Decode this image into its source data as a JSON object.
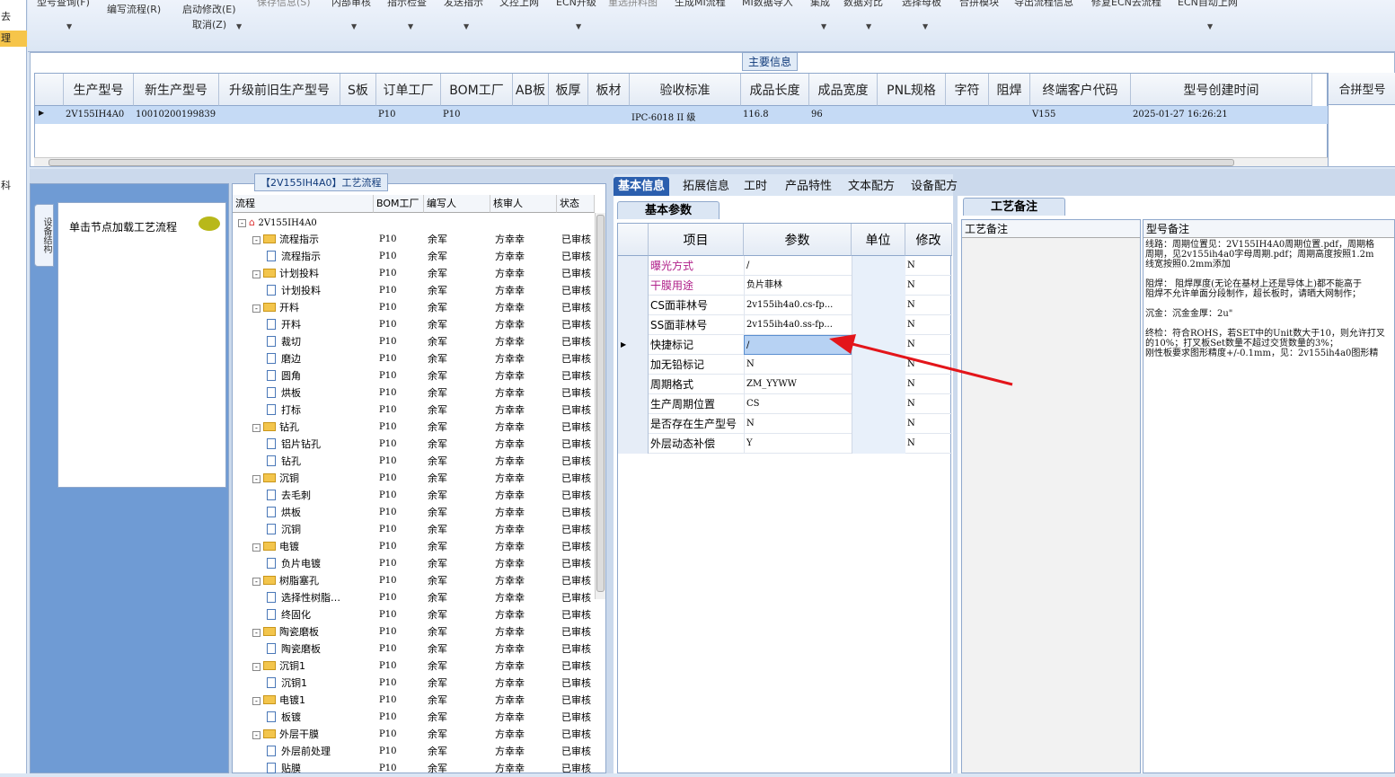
{
  "leftstrip": [
    "去",
    "理",
    "",
    "科"
  ],
  "ribbon": {
    "items": [
      {
        "label": "型号查询(F)",
        "dim": false
      },
      {
        "label": "编写流程(R)",
        "dim": false
      },
      {
        "label": "启动修改(E)",
        "dim": false
      },
      {
        "label": "取消(Z)",
        "dim": false
      },
      {
        "label": "保存信息(S)",
        "dim": true
      },
      {
        "label": "内部审核",
        "dim": false
      },
      {
        "label": "指示检查",
        "dim": false
      },
      {
        "label": "发送指示",
        "dim": false
      },
      {
        "label": "文控上网",
        "dim": false
      },
      {
        "label": "ECN升级",
        "dim": false
      },
      {
        "label": "重选拼料图",
        "dim": true
      },
      {
        "label": "生成MI流程",
        "dim": false
      },
      {
        "label": "MI数据导入",
        "dim": false
      },
      {
        "label": "集成",
        "dim": false
      },
      {
        "label": "数据对比",
        "dim": false
      },
      {
        "label": "选择母板",
        "dim": false
      },
      {
        "label": "合拼模块",
        "dim": false
      },
      {
        "label": "导出流程信息",
        "dim": false
      },
      {
        "label": "修复ECN去流程",
        "dim": false
      },
      {
        "label": "ECN自动上网",
        "dim": false
      }
    ]
  },
  "main_info": {
    "title": "主要信息",
    "columns": [
      "生产型号",
      "新生产型号",
      "升级前旧生产型号",
      "S板",
      "订单工厂",
      "BOM工厂",
      "AB板",
      "板厚",
      "板材",
      "验收标准",
      "成品长度",
      "成品宽度",
      "PNL规格",
      "字符",
      "阻焊",
      "终端客户代码",
      "型号创建时间"
    ],
    "row": {
      "生产型号": "2V155IH4A0",
      "新生产型号": "10010200199839",
      "订单工厂": "P10",
      "BOM工厂": "P10",
      "验收标准": "IPC-6018 II 级",
      "成品长度": "116.8",
      "成品宽度": "96",
      "终端客户代码": "V155",
      "型号创建时间": "2025-01-27 16:26:21"
    },
    "right_header": "合拼型号"
  },
  "left_panel": {
    "tab": "设备结构",
    "hint": "单击节点加载工艺流程"
  },
  "process_tree": {
    "title": "【2V155IH4A0】工艺流程",
    "columns": [
      "流程",
      "BOM工厂",
      "编写人",
      "核审人",
      "状态"
    ],
    "root": "2V155IH4A0",
    "rows": [
      {
        "name": "流程指示",
        "level": 1,
        "folder": true
      },
      {
        "name": "流程指示",
        "level": 2,
        "folder": false
      },
      {
        "name": "计划投料",
        "level": 1,
        "folder": true
      },
      {
        "name": "计划投料",
        "level": 2,
        "folder": false
      },
      {
        "name": "开料",
        "level": 1,
        "folder": true
      },
      {
        "name": "开料",
        "level": 2,
        "folder": false
      },
      {
        "name": "裁切",
        "level": 2,
        "folder": false
      },
      {
        "name": "磨边",
        "level": 2,
        "folder": false
      },
      {
        "name": "圆角",
        "level": 2,
        "folder": false
      },
      {
        "name": "烘板",
        "level": 2,
        "folder": false
      },
      {
        "name": "打标",
        "level": 2,
        "folder": false
      },
      {
        "name": "钻孔",
        "level": 1,
        "folder": true
      },
      {
        "name": "铝片钻孔",
        "level": 2,
        "folder": false
      },
      {
        "name": "钻孔",
        "level": 2,
        "folder": false
      },
      {
        "name": "沉铜",
        "level": 1,
        "folder": true
      },
      {
        "name": "去毛刺",
        "level": 2,
        "folder": false
      },
      {
        "name": "烘板",
        "level": 2,
        "folder": false
      },
      {
        "name": "沉铜",
        "level": 2,
        "folder": false
      },
      {
        "name": "电镀",
        "level": 1,
        "folder": true
      },
      {
        "name": "负片电镀",
        "level": 2,
        "folder": false
      },
      {
        "name": "树脂塞孔",
        "level": 1,
        "folder": true
      },
      {
        "name": "选择性树脂…",
        "level": 2,
        "folder": false
      },
      {
        "name": "终固化",
        "level": 2,
        "folder": false
      },
      {
        "name": "陶瓷磨板",
        "level": 1,
        "folder": true
      },
      {
        "name": "陶瓷磨板",
        "level": 2,
        "folder": false
      },
      {
        "name": "沉铜1",
        "level": 1,
        "folder": true
      },
      {
        "name": "沉铜1",
        "level": 2,
        "folder": false
      },
      {
        "name": "电镀1",
        "level": 1,
        "folder": true
      },
      {
        "name": "板镀",
        "level": 2,
        "folder": false
      },
      {
        "name": "外层干膜",
        "level": 1,
        "folder": true
      },
      {
        "name": "外层前处理",
        "level": 2,
        "folder": false
      },
      {
        "name": "贴膜",
        "level": 2,
        "folder": false
      }
    ],
    "bom": "P10",
    "writer": "余军",
    "reviewer": "方幸幸",
    "status": "已审核"
  },
  "detail_tabs": [
    "基本信息",
    "拓展信息",
    "工时",
    "产品特性",
    "文本配方",
    "设备配方"
  ],
  "basic_params": {
    "tab": "基本参数",
    "columns": [
      "项目",
      "参数",
      "单位",
      "修改"
    ],
    "rows": [
      {
        "item": "曝光方式",
        "param": "/",
        "unit": "",
        "mod": "N",
        "highlight": true
      },
      {
        "item": "干膜用途",
        "param": "负片菲林",
        "unit": "",
        "mod": "N",
        "highlight": true
      },
      {
        "item": "CS面菲林号",
        "param": "2v155ih4a0.cs-fp...",
        "unit": "",
        "mod": "N",
        "highlight": false
      },
      {
        "item": "SS面菲林号",
        "param": "2v155ih4a0.ss-fp...",
        "unit": "",
        "mod": "N",
        "highlight": false
      },
      {
        "item": "快捷标记",
        "param": "/",
        "unit": "",
        "mod": "N",
        "highlight": false
      },
      {
        "item": "加无铅标记",
        "param": "N",
        "unit": "",
        "mod": "N",
        "highlight": false
      },
      {
        "item": "周期格式",
        "param": "ZM_YYWW",
        "unit": "",
        "mod": "N",
        "highlight": false
      },
      {
        "item": "生产周期位置",
        "param": "CS",
        "unit": "",
        "mod": "N",
        "highlight": false
      },
      {
        "item": "是否存在生产型号",
        "param": "N",
        "unit": "",
        "mod": "N",
        "highlight": false
      },
      {
        "item": "外层动态补偿",
        "param": "Y",
        "unit": "",
        "mod": "N",
        "highlight": false
      }
    ]
  },
  "remarks": {
    "tab": "工艺备注",
    "col1": "工艺备注",
    "col2": "型号备注",
    "lines": [
      "线路：周期位置见：2V155IH4A0周期位置.pdf，周期格",
      "周期，见2v155ih4a0字母周期.pdf；周期高度按照1.2m",
      "线宽按照0.2mm添加",
      "",
      "阻焊：  阻焊厚度(无论在基材上还是导体上)都不能高于",
      "阻焊不允许单面分段制作，超长板时，请晒大网制作；",
      "",
      "沉金：沉金金厚：2u\"",
      "",
      "终检：符合ROHS，若SET中的Unit数大于10，则允许打叉",
      "的10%；打叉板Set数量不超过交货数量的3%；",
      "刚性板要求图形精度+/-0.1mm，见：2v155ih4a0图形精"
    ]
  }
}
